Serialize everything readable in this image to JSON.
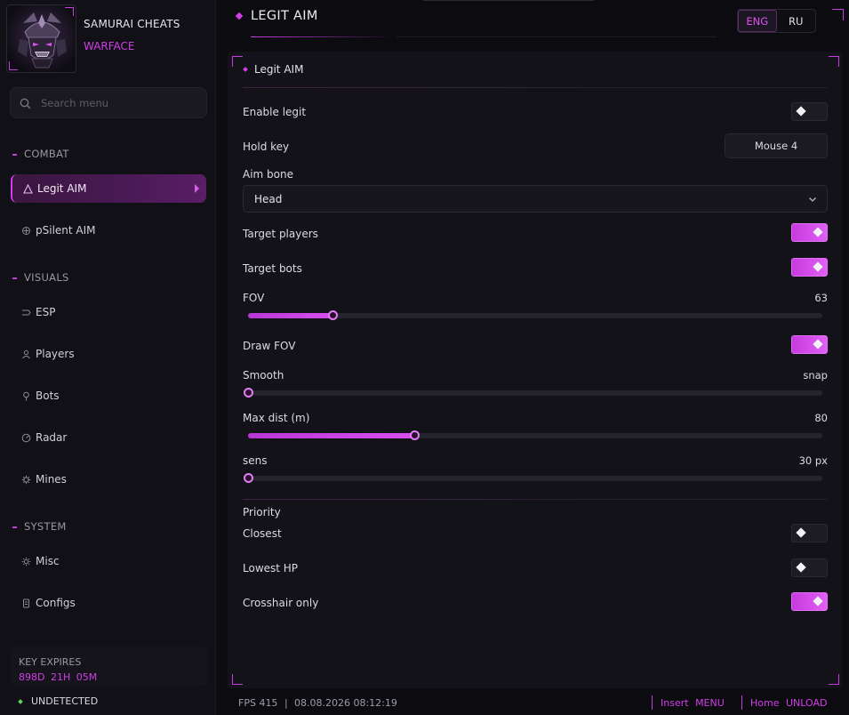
{
  "app": {
    "brand": "SAMURAI CHEATS",
    "game": "WARFACE"
  },
  "search": {
    "placeholder": "Search menu"
  },
  "sidebar": {
    "sections": [
      {
        "label": "COMBAT"
      },
      {
        "label": "VISUALS"
      },
      {
        "label": "SYSTEM"
      }
    ],
    "items": [
      {
        "label": "Legit AIM",
        "icon": "triangle-icon",
        "active": true
      },
      {
        "label": "pSilent AIM",
        "icon": "crosshair-icon"
      },
      {
        "label": "ESP",
        "icon": "chevron-right-icon"
      },
      {
        "label": "Players",
        "icon": "user-icon"
      },
      {
        "label": "Bots",
        "icon": "bulb-icon"
      },
      {
        "label": "Radar",
        "icon": "radar-icon"
      },
      {
        "label": "Mines",
        "icon": "mine-icon"
      },
      {
        "label": "Misc",
        "icon": "gear-icon"
      },
      {
        "label": "Configs",
        "icon": "file-icon"
      }
    ],
    "key_expires_label": "KEY EXPIRES",
    "key_expires_value": "898D  21H  05M",
    "status": "UNDETECTED"
  },
  "header": {
    "title": "LEGIT AIM",
    "languages": [
      "ENG",
      "RU"
    ],
    "selected_language": "ENG"
  },
  "panel": {
    "title": "Legit AIM",
    "enable_legit": {
      "label": "Enable legit",
      "on": false
    },
    "hold_key": {
      "label": "Hold key",
      "value": "Mouse 4"
    },
    "aim_bone": {
      "label": "Aim bone",
      "value": "Head"
    },
    "target_players": {
      "label": "Target players",
      "on": true
    },
    "target_bots": {
      "label": "Target bots",
      "on": true
    },
    "fov": {
      "label": "FOV",
      "value_text": "63",
      "fraction": 0.147
    },
    "draw_fov": {
      "label": "Draw FOV",
      "on": true
    },
    "smooth": {
      "label": "Smooth",
      "value_text": "snap",
      "fraction": 0.0
    },
    "max_dist": {
      "label": "Max dist (m)",
      "value_text": "80",
      "fraction": 0.29
    },
    "sens": {
      "label": "sens",
      "value_text": "30 px",
      "fraction": 0.0
    },
    "priority": {
      "label": "Priority",
      "closest": {
        "label": "Closest",
        "on": false
      },
      "lowest_hp": {
        "label": "Lowest HP",
        "on": false
      },
      "crosshair_only": {
        "label": "Crosshair only",
        "on": true
      }
    }
  },
  "statusbar": {
    "fps": "FPS 415",
    "datetime": "08.08.2026 08:12:19",
    "insert_key": "Insert",
    "insert_action": "MENU",
    "home_key": "Home",
    "home_action": "UNLOAD"
  },
  "colors": {
    "accent": "#d13ee8",
    "background": "#0c0b10",
    "panel": "#131218"
  }
}
